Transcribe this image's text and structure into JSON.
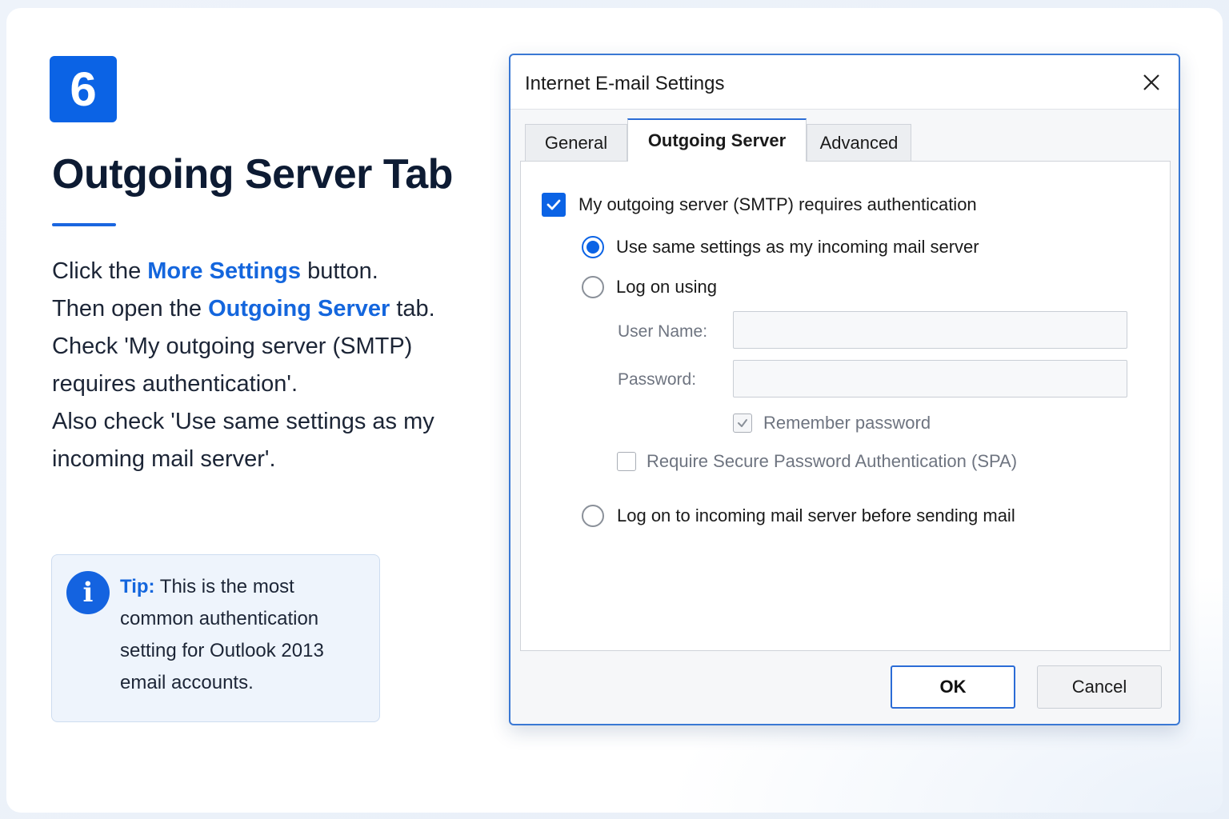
{
  "step": {
    "number": "6",
    "title": "Outgoing Server Tab",
    "instructions": {
      "p1_a": "Click the ",
      "p1_hl": "More Settings",
      "p1_b": " button.",
      "p2_a": "Then open the ",
      "p2_hl": "Outgoing Server",
      "p2_b": " tab.",
      "p3": "Check 'My outgoing server (SMTP) requires authentication'.",
      "p4": "Also check 'Use same settings as my incoming mail server'."
    },
    "tip": {
      "label": "Tip:",
      "text": " This is the most common authentication setting for Outlook 2013 email accounts."
    }
  },
  "dialog": {
    "title": "Internet E-mail Settings",
    "tabs": [
      "General",
      "Outgoing Server",
      "Advanced"
    ],
    "active_tab": "Outgoing Server",
    "smtp_auth_label": "My outgoing server (SMTP) requires authentication",
    "smtp_auth_checked": true,
    "radio_same_label": "Use same settings as my incoming mail server",
    "radio_logon_label": "Log on using",
    "user_name_label": "User Name:",
    "user_name_value": "",
    "password_label": "Password:",
    "password_value": "",
    "remember_label": "Remember password",
    "remember_checked": true,
    "spa_label": "Require Secure Password Authentication (SPA)",
    "spa_checked": false,
    "radio_before_label": "Log on to incoming mail server before sending mail",
    "selected_radio": "same",
    "ok_label": "OK",
    "cancel_label": "Cancel"
  },
  "colors": {
    "accent": "#0b63e5",
    "highlight_text": "#1466dd",
    "title_text": "#0d1b33"
  }
}
